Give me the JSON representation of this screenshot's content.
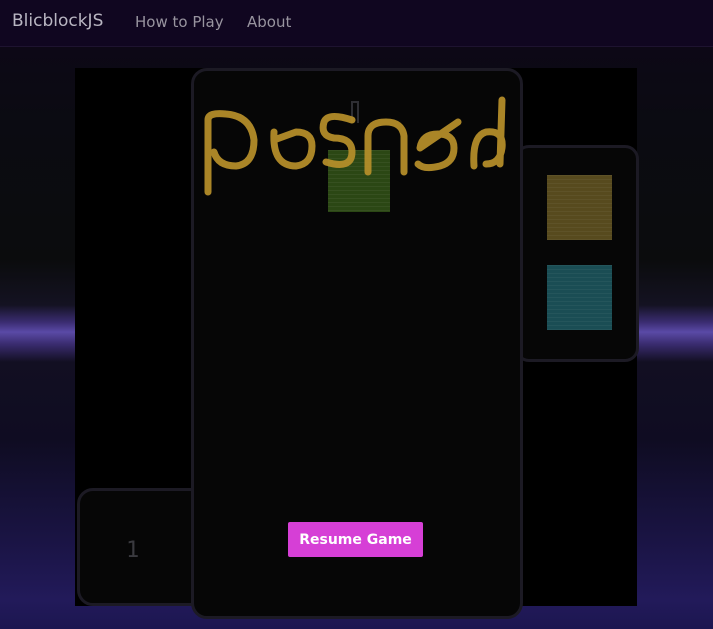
{
  "navbar": {
    "brand": "BlicblockJS",
    "links": [
      "How to Play",
      "About"
    ]
  },
  "game": {
    "status_overlay_text": "paused",
    "level": "1",
    "resume_button": "Resume Game",
    "next_pieces": [
      {
        "color": "#574a1e"
      },
      {
        "color": "#1a4d54"
      }
    ],
    "falling_piece": {
      "color": "#2b4714"
    }
  },
  "colors": {
    "accent": "#d63fd6",
    "overlay_text": "#b8902a",
    "background": "#000000"
  }
}
